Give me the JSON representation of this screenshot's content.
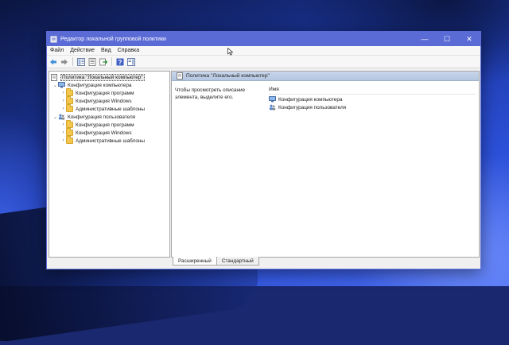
{
  "window": {
    "title": "Редактор локальной групповой политики",
    "controls": [
      "—",
      "☐",
      "✕"
    ]
  },
  "menu": [
    "Файл",
    "Действие",
    "Вид",
    "Справка"
  ],
  "toolbar": [
    "back-arrow-icon",
    "forward-arrow-icon",
    "show-hide-tree-icon",
    "properties-icon",
    "export-list-icon",
    "help-icon",
    "show-hide-action-pane-icon"
  ],
  "tree": {
    "root": "Политика \"Локальный компьютер\"",
    "computer": {
      "label": "Конфигурация компьютера",
      "children": [
        "Конфигурация программ",
        "Конфигурация Windows",
        "Административные шаблоны"
      ]
    },
    "user": {
      "label": "Конфигурация пользователя",
      "children": [
        "Конфигурация программ",
        "Конфигурация Windows",
        "Административные шаблоны"
      ]
    }
  },
  "details": {
    "header": "Политика \"Локальный компьютер\"",
    "description": "Чтобы просмотреть описание элемента, выделите его.",
    "column_name": "Имя",
    "items": [
      "Конфигурация компьютера",
      "Конфигурация пользователя"
    ]
  },
  "tabs": [
    "Расширенный",
    "Стандартный"
  ],
  "colors": {
    "titlebar": "#5b6bd6",
    "header_band": "#b4c6e2",
    "folder": "#f3c64c"
  }
}
